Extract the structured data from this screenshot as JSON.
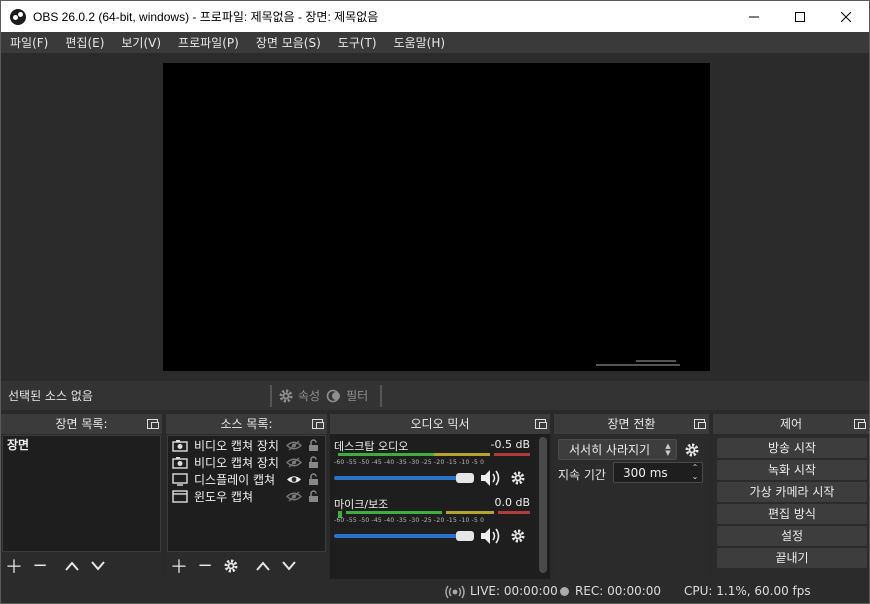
{
  "window": {
    "title": "OBS 26.0.2 (64-bit, windows) - 프로파일: 제목없음 - 장면: 제목없음",
    "minimize": "—",
    "maximize": "☐",
    "close": "✕"
  },
  "menu": [
    "파일(F)",
    "편집(E)",
    "보기(V)",
    "프로파일(P)",
    "장면 모음(S)",
    "도구(T)",
    "도움말(H)"
  ],
  "sourcebar": {
    "no_selection": "선택된 소스 없음",
    "properties": "속성",
    "filters": "필터"
  },
  "scenes": {
    "title": "장면 목록:",
    "items": [
      "장면"
    ]
  },
  "sources": {
    "title": "소스 목록:",
    "items": [
      {
        "name": "비디오 캡쳐 장치",
        "icon": "camera-icon",
        "visible": false
      },
      {
        "name": "비디오 캡쳐 장치",
        "icon": "camera-icon",
        "visible": false
      },
      {
        "name": "디스플레이 캡쳐",
        "icon": "monitor-icon",
        "visible": true
      },
      {
        "name": "윈도우 캡쳐",
        "icon": "window-icon",
        "visible": false
      }
    ]
  },
  "mixer": {
    "title": "오디오 믹서",
    "tracks": [
      {
        "name": "데스크탑 오디오",
        "level": "-0.5 dB",
        "volume": 0.97
      },
      {
        "name": "마이크/보조",
        "level": "0.0 dB",
        "volume": 1.0
      }
    ],
    "ticks": "-60 -55 -50 -45 -40 -35 -30 -25 -20 -15 -10 -5 0"
  },
  "transitions": {
    "title": "장면 전환",
    "selected": "서서히 사라지기",
    "duration_label": "지속 기간",
    "duration_value": "300 ms"
  },
  "controls": {
    "title": "제어",
    "buttons": [
      "방송 시작",
      "녹화 시작",
      "가상 카메라 시작",
      "편집 방식",
      "설정",
      "끝내기"
    ]
  },
  "status": {
    "live": "LIVE: 00:00:00",
    "rec": "REC: 00:00:00",
    "cpu": "CPU: 1.1%, 60.00 fps"
  },
  "colors": {
    "accent_blue": "#2b72c9",
    "meter_green": "#3fae3f",
    "meter_yellow": "#b5a32e",
    "meter_red": "#b33a3a"
  }
}
